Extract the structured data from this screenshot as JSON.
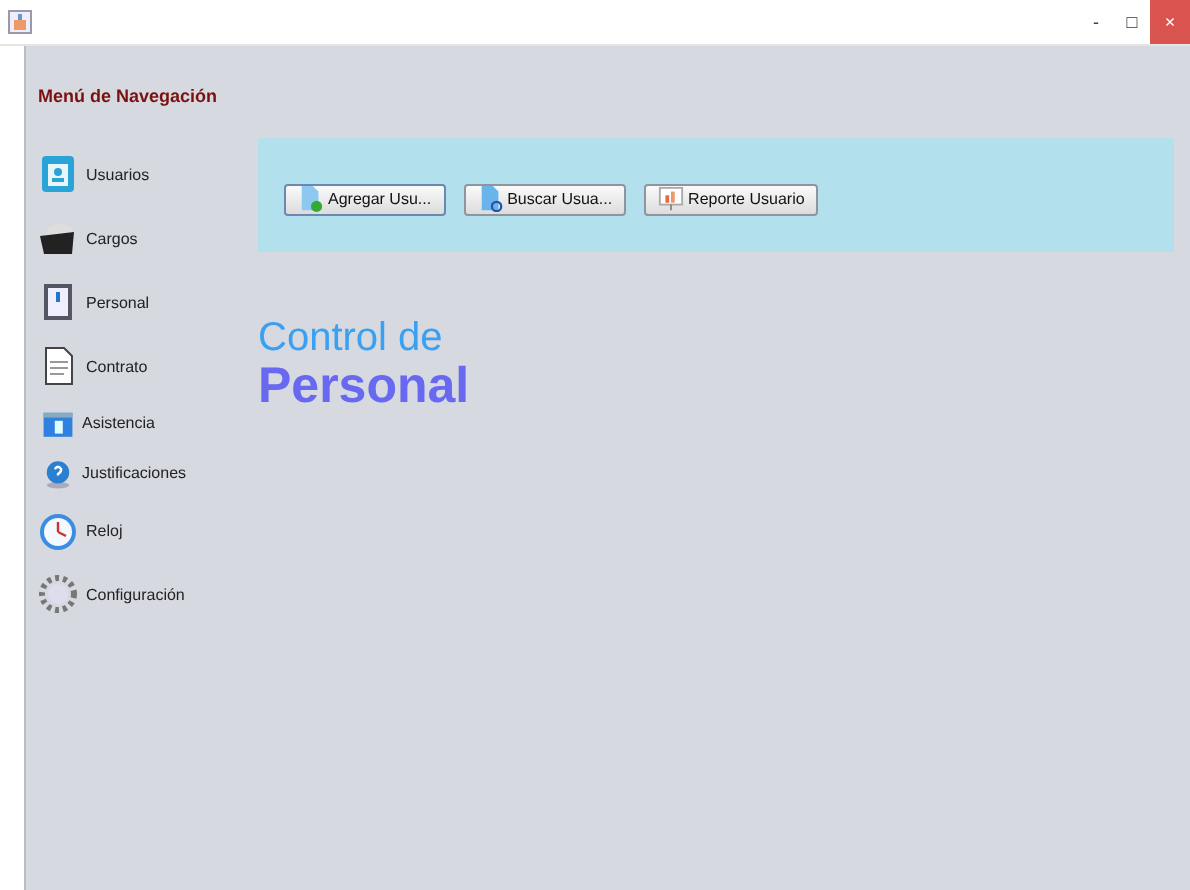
{
  "window": {
    "controls": [
      "-",
      "□",
      "×"
    ]
  },
  "sidebar": {
    "title": "Menú de Navegación",
    "items": [
      {
        "label": "Usuarios"
      },
      {
        "label": "Cargos"
      },
      {
        "label": "Personal"
      },
      {
        "label": "Contrato"
      },
      {
        "label": "Asistencia"
      },
      {
        "label": "Justificaciones"
      },
      {
        "label": "Reloj"
      },
      {
        "label": "Configuración"
      }
    ]
  },
  "toolbar": {
    "buttons": [
      "Agregar Usu...",
      "Buscar Usua...",
      "Reporte Usuario"
    ]
  },
  "heading": {
    "line_1": "Control de",
    "line_2": "Personal"
  }
}
